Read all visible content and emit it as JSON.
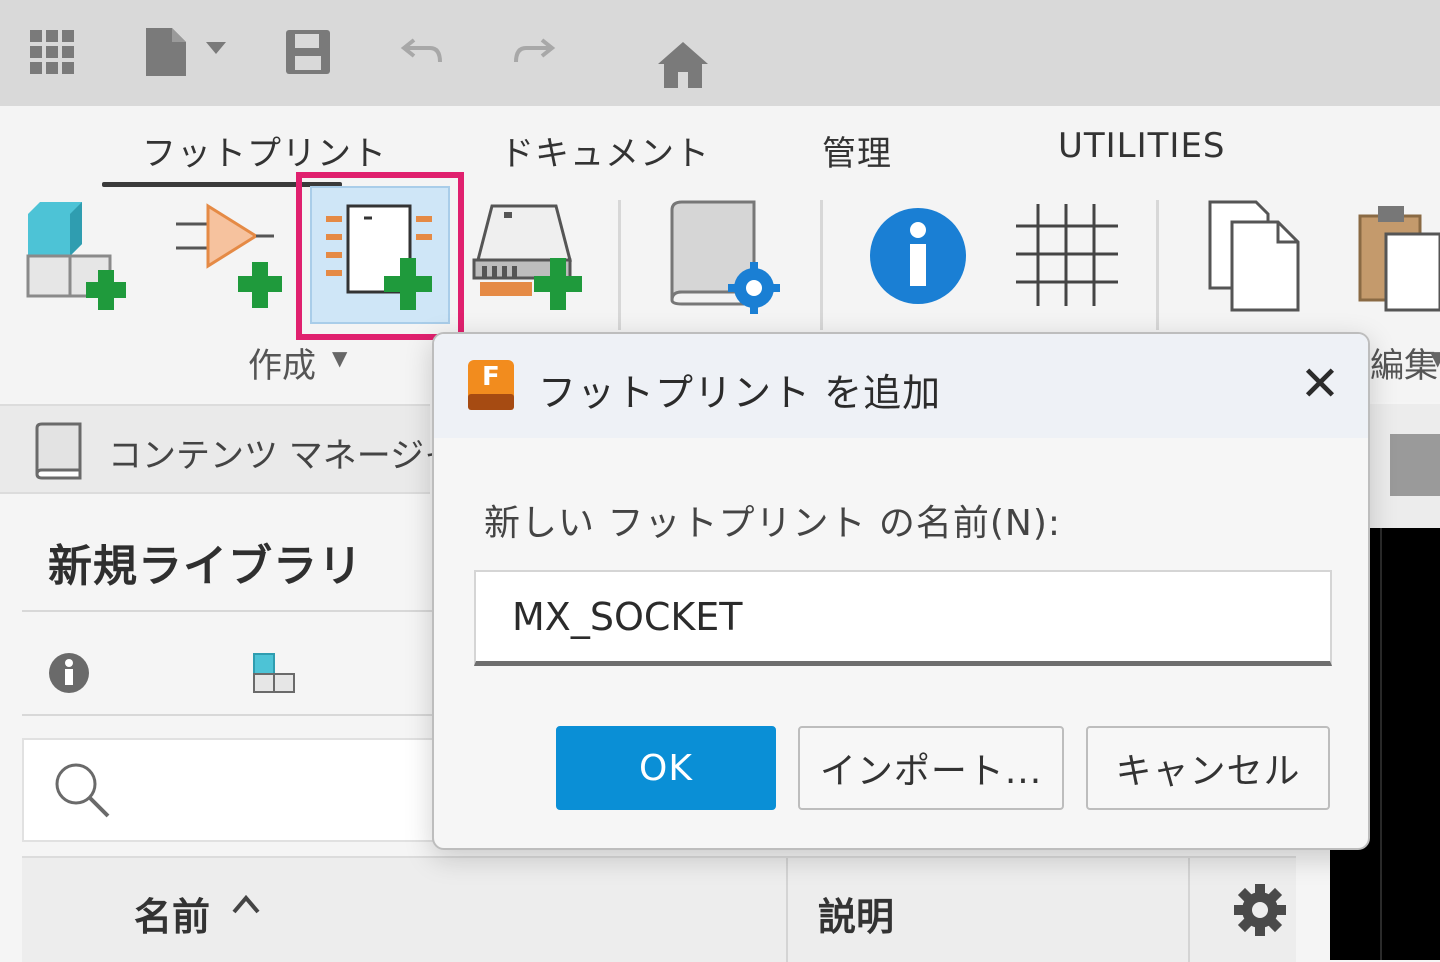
{
  "quick_access": {
    "icons": [
      "app-grid-icon",
      "file-icon",
      "save-icon",
      "undo-icon",
      "redo-icon",
      "home-icon"
    ]
  },
  "ribbon": {
    "tabs": [
      "フットプリント",
      "ドキュメント",
      "管理",
      "UTILITIES"
    ],
    "active_tab_index": 0,
    "group_create_label": "作成",
    "group_edit_label": "編集",
    "tools": [
      "new-component-icon",
      "new-symbol-icon",
      "new-footprint-icon",
      "new-package-icon",
      "library-settings-icon",
      "info-icon",
      "grid-icon",
      "copy-icon",
      "paste-icon"
    ]
  },
  "left_panel": {
    "content_manager_label": "コンテンツ マネージャ",
    "library_title": "新規ライブラリ",
    "table_headers": {
      "name": "名前",
      "description": "説明"
    }
  },
  "dialog": {
    "title": "フットプリント を追加",
    "app_badge_letter": "F",
    "field_label": "新しい フットプリント の名前(N):",
    "field_value": "MX_SOCKET",
    "ok_label": "OK",
    "import_label": "インポート...",
    "cancel_label": "キャンセル"
  },
  "colors": {
    "highlight": "#e0206e",
    "primary_button": "#0a8fd6",
    "add_plus": "#1f9a3c",
    "info": "#1a7fd4"
  }
}
